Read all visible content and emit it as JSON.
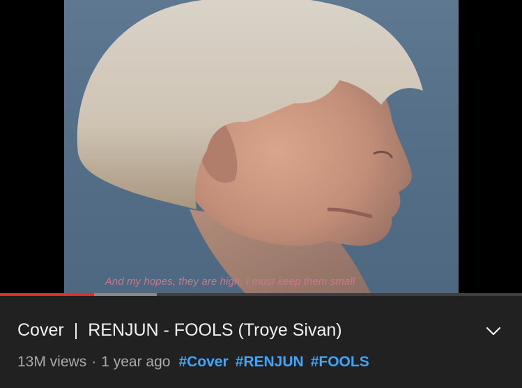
{
  "video": {
    "subtitle": "And my hopes, they are high, I must keep them small",
    "progress": {
      "played_fraction": 0.18,
      "buffered_fraction": 0.3
    }
  },
  "info": {
    "title_prefix": "Cover",
    "title_separator": "|",
    "title_main": "RENJUN - FOOLS (Troye Sivan)",
    "views": "13M views",
    "dot": "·",
    "age": "1 year ago",
    "hashtags": [
      "#Cover",
      "#RENJUN",
      "#FOOLS"
    ],
    "expand_icon": "chevron-down-icon"
  },
  "colors": {
    "background": "#212121",
    "progress_played": "#e52d27",
    "hashtag": "#3ea6ff",
    "meta_text": "#aaaaaa",
    "title_text": "#f1f1f1"
  }
}
